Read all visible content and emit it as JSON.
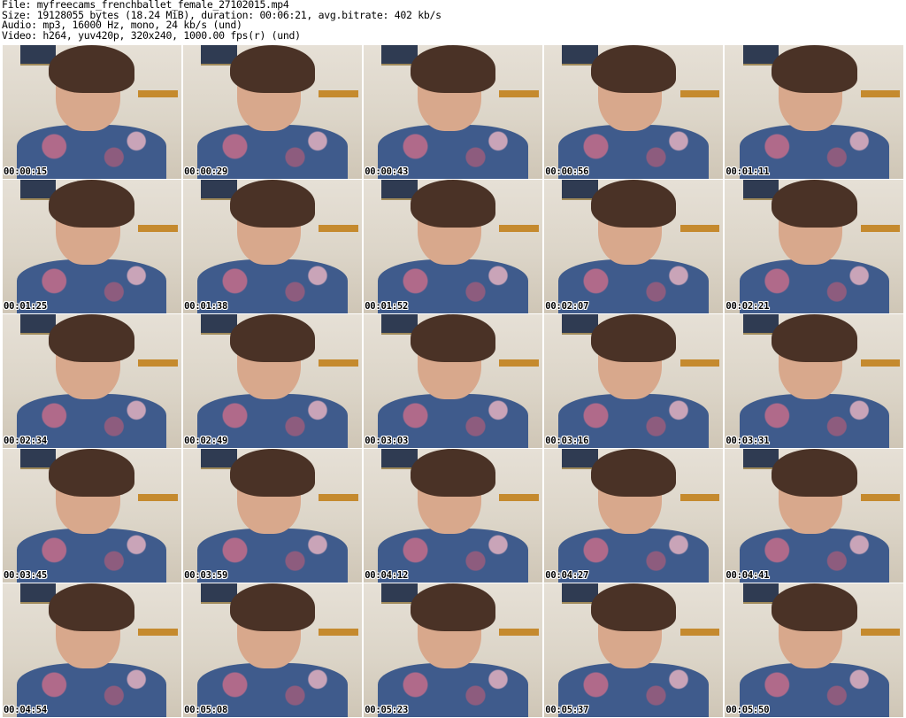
{
  "header": {
    "file_line": "File: myfreecams_frenchballet_female_27102015.mp4",
    "size_line": "Size: 19128055 bytes (18.24 MiB), duration: 00:06:21, avg.bitrate: 402 kb/s",
    "audio_line": "Audio: mp3, 16000 Hz, mono, 24 kb/s (und)",
    "video_line": "Video: h264, yuv420p, 320x240, 1000.00 fps(r) (und)"
  },
  "thumbnails": [
    {
      "timestamp": "00:00:15"
    },
    {
      "timestamp": "00:00:29"
    },
    {
      "timestamp": "00:00:43"
    },
    {
      "timestamp": "00:00:56"
    },
    {
      "timestamp": "00:01:11"
    },
    {
      "timestamp": "00:01:25"
    },
    {
      "timestamp": "00:01:38"
    },
    {
      "timestamp": "00:01:52"
    },
    {
      "timestamp": "00:02:07"
    },
    {
      "timestamp": "00:02:21"
    },
    {
      "timestamp": "00:02:34"
    },
    {
      "timestamp": "00:02:49"
    },
    {
      "timestamp": "00:03:03"
    },
    {
      "timestamp": "00:03:16"
    },
    {
      "timestamp": "00:03:31"
    },
    {
      "timestamp": "00:03:45"
    },
    {
      "timestamp": "00:03:59"
    },
    {
      "timestamp": "00:04:12"
    },
    {
      "timestamp": "00:04:27"
    },
    {
      "timestamp": "00:04:41"
    },
    {
      "timestamp": "00:04:54"
    },
    {
      "timestamp": "00:05:08"
    },
    {
      "timestamp": "00:05:23"
    },
    {
      "timestamp": "00:05:37"
    },
    {
      "timestamp": "00:05:50"
    }
  ]
}
